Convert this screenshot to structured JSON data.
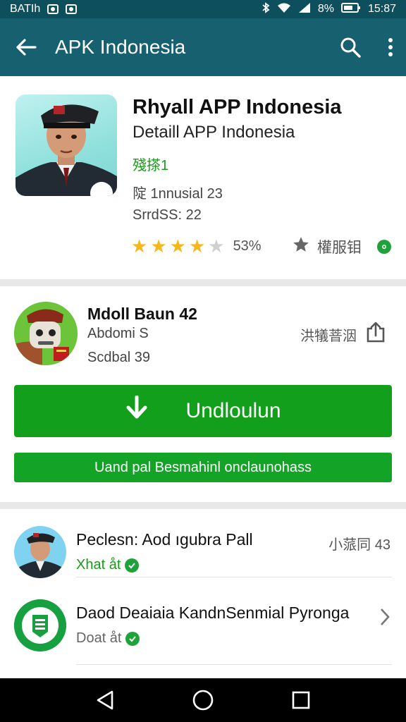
{
  "status_bar": {
    "left_text": "BATIh",
    "right_text": "8%",
    "time": "15:87"
  },
  "app_bar": {
    "title": "APK Indonesia"
  },
  "app": {
    "title": "Rhyall APP Indonesia",
    "subtitle": "Detaill APP Indonesia",
    "developer": "殘搽1",
    "meta_line_1": "䧑 1nnusial 23",
    "meta_line_2": "SrrdSS: 22",
    "rating_stars": 4,
    "rating_max": 5,
    "rating_label": "53%",
    "wishlist_label": "權服钼"
  },
  "version_card": {
    "title": "Mdoll Baun 42",
    "line_1": "Abdomi S",
    "line_2": "Scdbal 39",
    "share_label": "洪犠萻洇",
    "download_label": "Undloulun",
    "secondary_label": "Uand pal Besmahinl onclaunohass"
  },
  "related": [
    {
      "name": "Peclesn: Aod ıgubra Pall",
      "sub": "Xhat åt",
      "right": "小蒎同 43"
    },
    {
      "name": "Daod Deaiaia KandnSenmial Pyronga",
      "sub": "Doat åt",
      "right": ""
    }
  ],
  "colors": {
    "status_bar": "#0e4f5e",
    "app_bar": "#16606f",
    "download_green": "#119f1c",
    "developer_green": "#1a9a1a",
    "star_gold": "#f5b81a"
  },
  "icons": [
    "back-arrow-icon",
    "search-icon",
    "more-vert-icon",
    "star-outline-icon",
    "share-icon",
    "download-icon",
    "verified-badge-icon",
    "chevron-right-icon",
    "nav-back-icon",
    "nav-home-icon",
    "nav-recents-icon"
  ]
}
